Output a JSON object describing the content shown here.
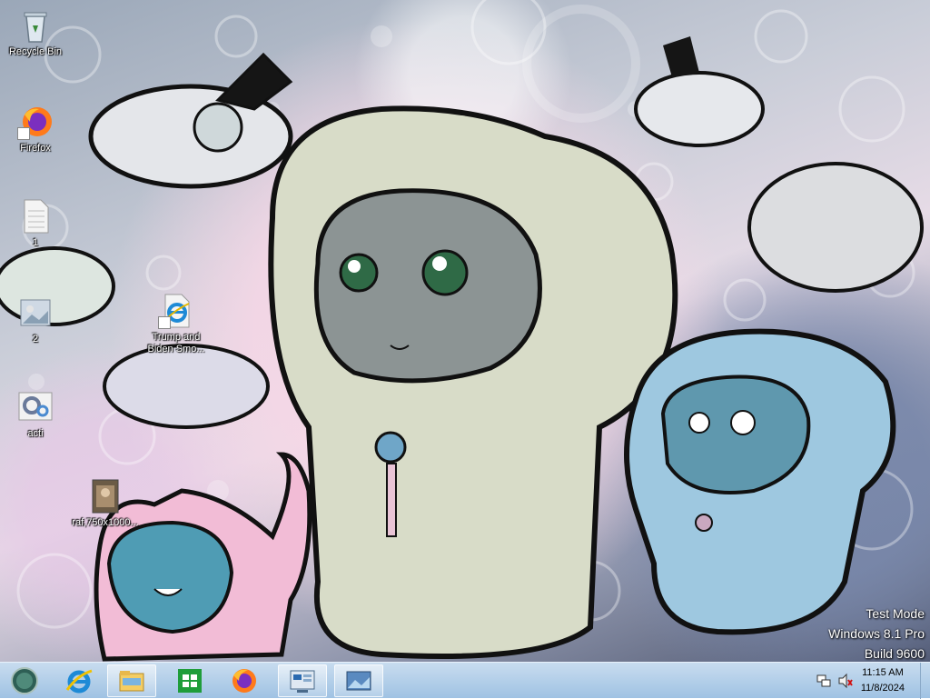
{
  "desktop": {
    "icons": [
      {
        "id": "recycle-bin",
        "label": "Recycle Bin",
        "icon": "recycle-bin-icon"
      },
      {
        "id": "firefox",
        "label": "Firefox",
        "icon": "firefox-icon"
      },
      {
        "id": "file-1",
        "label": "1",
        "icon": "document-icon"
      },
      {
        "id": "file-2",
        "label": "2",
        "icon": "image-file-icon"
      },
      {
        "id": "trump-biden",
        "label": "Trump and Biden Smo...",
        "icon": "internet-explorer-file-icon"
      },
      {
        "id": "acti",
        "label": "acti",
        "icon": "settings-file-icon"
      },
      {
        "id": "raf-image",
        "label": "raf,750x1000...",
        "icon": "image-thumbnail-icon"
      }
    ]
  },
  "watermark": {
    "line1": "Test Mode",
    "line2": "Windows 8.1 Pro",
    "line3": "Build 9600"
  },
  "taskbar": {
    "pinned": [
      {
        "name": "start",
        "icon": "windows-start-icon"
      },
      {
        "name": "internet-explorer",
        "icon": "internet-explorer-icon"
      },
      {
        "name": "file-explorer",
        "icon": "folder-icon"
      },
      {
        "name": "store",
        "icon": "windows-store-icon"
      },
      {
        "name": "firefox",
        "icon": "firefox-icon"
      },
      {
        "name": "control-panel",
        "icon": "control-panel-icon"
      },
      {
        "name": "photos",
        "icon": "picture-viewer-icon"
      }
    ],
    "tray": {
      "network": "network-icon",
      "volume": "volume-muted-icon"
    },
    "clock": {
      "time": "11:15 AM",
      "date": "11/8/2024"
    }
  },
  "colors": {
    "taskbar_top": "#c8dcef",
    "taskbar_bottom": "#9fc2e3",
    "accent": "#2a6ab0"
  }
}
